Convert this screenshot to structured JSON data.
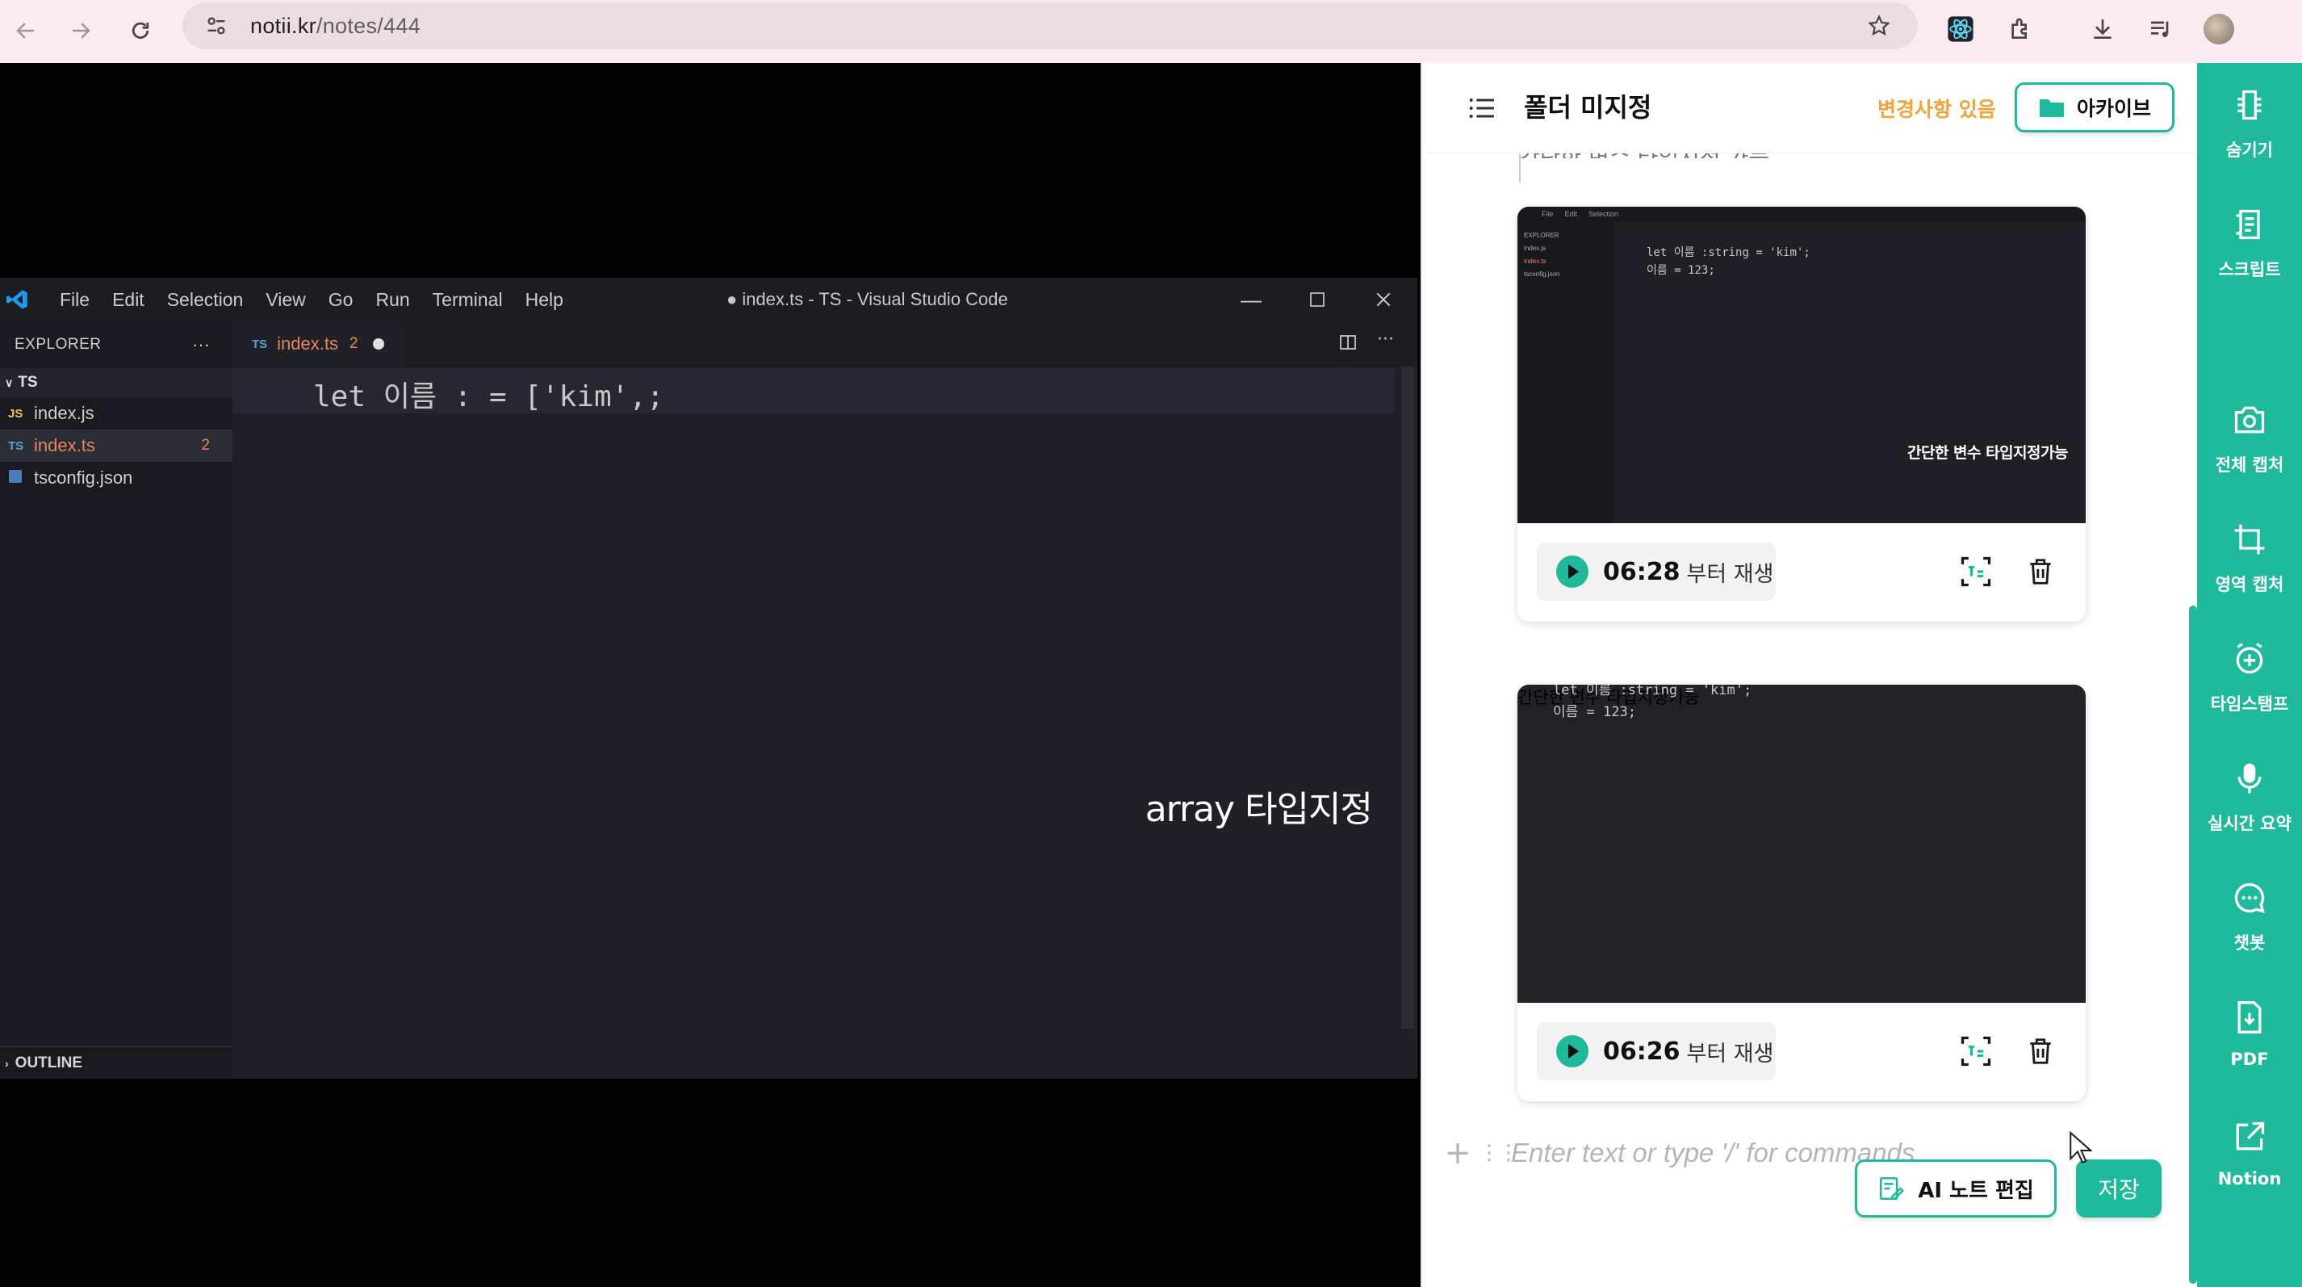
{
  "browser": {
    "url_host": "notii.kr",
    "url_path": "/notes/444"
  },
  "vscode": {
    "menu": [
      "File",
      "Edit",
      "Selection",
      "View",
      "Go",
      "Run",
      "Terminal",
      "Help"
    ],
    "window_title": "● index.ts - TS - Visual Studio Code",
    "explorer_label": "EXPLORER",
    "folder": "TS",
    "files": [
      {
        "icon": "JS",
        "name": "index.js",
        "badge": ""
      },
      {
        "icon": "TS",
        "name": "index.ts",
        "badge": "2"
      },
      {
        "icon": "{}",
        "name": "tsconfig.json",
        "badge": ""
      }
    ],
    "outline_label": "OUTLINE",
    "tab": {
      "icon": "TS",
      "name": "index.ts",
      "count": "2"
    },
    "code_line": "let 이름 : = ['kim',;",
    "caption": "array 타입지정"
  },
  "note": {
    "folder_name": "폴더 미지정",
    "changes_label": "변경사항 있음",
    "archive_label": "아카이브",
    "cut_text": "간단한 변수 타입지정 가능",
    "cards": [
      {
        "code_lines": [
          "let 이름 :string = 'kim';",
          "이름 = 123;"
        ],
        "caption": "간단한 변수 타입지정가능",
        "time": "06:28",
        "from_label": "부터 재생"
      },
      {
        "code_lines": [
          "let 이름 :string = 'kim';",
          "이름 = 123;"
        ],
        "caption": "간단한 변수 타입지정가능",
        "time": "06:26",
        "from_label": "부터 재생"
      }
    ],
    "command_placeholder": "Enter text or type '/' for commands",
    "ai_edit_label": "AI 노트 편집",
    "save_label": "저장"
  },
  "rail": [
    {
      "icon": "hide-icon",
      "label": "숨기기"
    },
    {
      "icon": "script-icon",
      "label": "스크립트"
    },
    {
      "icon": "camera-icon",
      "label": "전체 캡처"
    },
    {
      "icon": "crop-icon",
      "label": "영역 캡처"
    },
    {
      "icon": "timestamp-icon",
      "label": "타임스탬프"
    },
    {
      "icon": "mic-icon",
      "label": "실시간 요약"
    },
    {
      "icon": "chat-icon",
      "label": "챗봇"
    },
    {
      "icon": "pdf-icon",
      "label": "PDF"
    },
    {
      "icon": "notion-icon",
      "label": "Notion"
    }
  ],
  "colors": {
    "accent": "#1fb99c",
    "warning": "#f0a43a",
    "chrome": "#fbeaf0"
  }
}
